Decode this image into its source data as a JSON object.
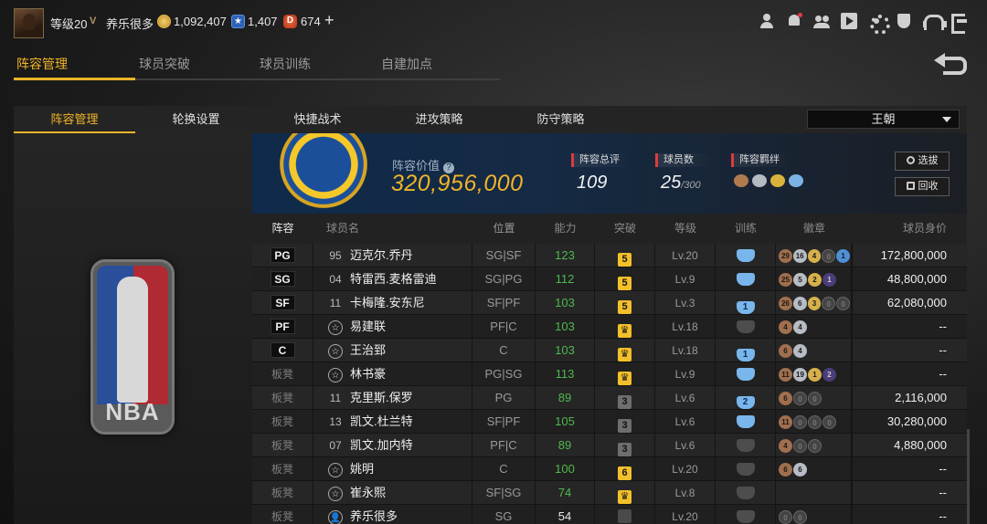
{
  "topbar": {
    "level": "等级20",
    "vip": "V",
    "username": "养乐很多",
    "gold": "1,092,407",
    "stars": "1,407",
    "diamonds": "674",
    "plus": "+",
    "icons": [
      "user-icon",
      "bell-icon",
      "friends-icon",
      "video-icon",
      "gear-icon",
      "shield-icon",
      "headset-icon",
      "exit-icon"
    ]
  },
  "main_tabs": [
    "阵容管理",
    "球员突破",
    "球员训练",
    "自建加点"
  ],
  "sub_tabs": [
    "阵容管理",
    "轮换设置",
    "快捷战术",
    "进攻策略",
    "防守策略"
  ],
  "team_select": "王朝",
  "info": {
    "value_label": "阵容价值",
    "value": "320,956,000",
    "rating_label": "阵容总评",
    "rating": "109",
    "count_label": "球员数",
    "count": "25",
    "count_max": "/300",
    "chem_label": "阵容羁绊",
    "scout_btn": "选拔",
    "recycle_btn": "回收"
  },
  "table": {
    "headers": [
      "阵容",
      "球员名",
      "位置",
      "能力",
      "突破",
      "等级",
      "训练",
      "徽章",
      "球员身价"
    ],
    "rows": [
      {
        "slot": "PG",
        "jersey": "95",
        "name": "迈克尔.乔丹",
        "pos": "SG|SF",
        "ability": "123",
        "bt": "5",
        "level": "Lv.20",
        "train": "",
        "badges": [
          "29",
          "16",
          "4",
          "0",
          "1"
        ],
        "price": "172,800,000"
      },
      {
        "slot": "SG",
        "jersey": "04",
        "name": "特雷西.麦格雷迪",
        "pos": "SG|PG",
        "ability": "112",
        "bt": "5",
        "level": "Lv.9",
        "train": "",
        "badges": [
          "25",
          "5",
          "2",
          "1"
        ],
        "price": "48,800,000"
      },
      {
        "slot": "SF",
        "jersey": "11",
        "name": "卡梅隆.安东尼",
        "pos": "SF|PF",
        "ability": "103",
        "bt": "5",
        "level": "Lv.3",
        "train": "1",
        "badges": [
          "26",
          "6",
          "3",
          "0",
          "0"
        ],
        "price": "62,080,000"
      },
      {
        "slot": "PF",
        "jersey": "☆",
        "name": "易建联",
        "pos": "PF|C",
        "ability": "103",
        "bt": "♛",
        "level": "Lv.18",
        "train": "",
        "badges": [
          "4",
          "4"
        ],
        "price": "--"
      },
      {
        "slot": "C",
        "jersey": "☆",
        "name": "王治郅",
        "pos": "C",
        "ability": "103",
        "bt": "♛",
        "level": "Lv.18",
        "train": "1",
        "badges": [
          "6",
          "4"
        ],
        "price": "--"
      },
      {
        "slot": "板凳",
        "jersey": "☆",
        "name": "林书豪",
        "pos": "PG|SG",
        "ability": "113",
        "bt": "♛",
        "level": "Lv.9",
        "train": "",
        "badges": [
          "11",
          "19",
          "1",
          "2"
        ],
        "price": "--"
      },
      {
        "slot": "板凳",
        "jersey": "11",
        "name": "克里斯.保罗",
        "pos": "PG",
        "ability": "89",
        "bt": "3",
        "level": "Lv.6",
        "train": "2",
        "badges": [
          "6",
          "0",
          "0"
        ],
        "price": "2,116,000"
      },
      {
        "slot": "板凳",
        "jersey": "13",
        "name": "凯文.杜兰特",
        "pos": "SF|PF",
        "ability": "105",
        "bt": "3",
        "level": "Lv.6",
        "train": "",
        "badges": [
          "11",
          "0",
          "0",
          "0"
        ],
        "price": "30,280,000"
      },
      {
        "slot": "板凳",
        "jersey": "07",
        "name": "凯文.加内特",
        "pos": "PF|C",
        "ability": "89",
        "bt": "3",
        "level": "Lv.6",
        "train": "",
        "badges": [
          "4",
          "0",
          "0"
        ],
        "price": "4,880,000"
      },
      {
        "slot": "板凳",
        "jersey": "☆",
        "name": "姚明",
        "pos": "C",
        "ability": "100",
        "bt": "6",
        "level": "Lv.20",
        "train": "",
        "badges": [
          "6",
          "6"
        ],
        "price": "--"
      },
      {
        "slot": "板凳",
        "jersey": "☆",
        "name": "崔永熙",
        "pos": "SF|SG",
        "ability": "74",
        "bt": "♛",
        "level": "Lv.8",
        "train": "",
        "badges": [],
        "price": "--"
      },
      {
        "slot": "板凳",
        "jersey": "👤",
        "name": "养乐很多",
        "pos": "SG",
        "ability": "54",
        "bt": "",
        "level": "Lv.20",
        "train": "",
        "badges": [
          "0",
          "0"
        ],
        "price": "--"
      }
    ]
  },
  "colors": {
    "accent": "#f0b429",
    "ability_green": "#4fb84e",
    "value_gold": "#f0b429"
  }
}
